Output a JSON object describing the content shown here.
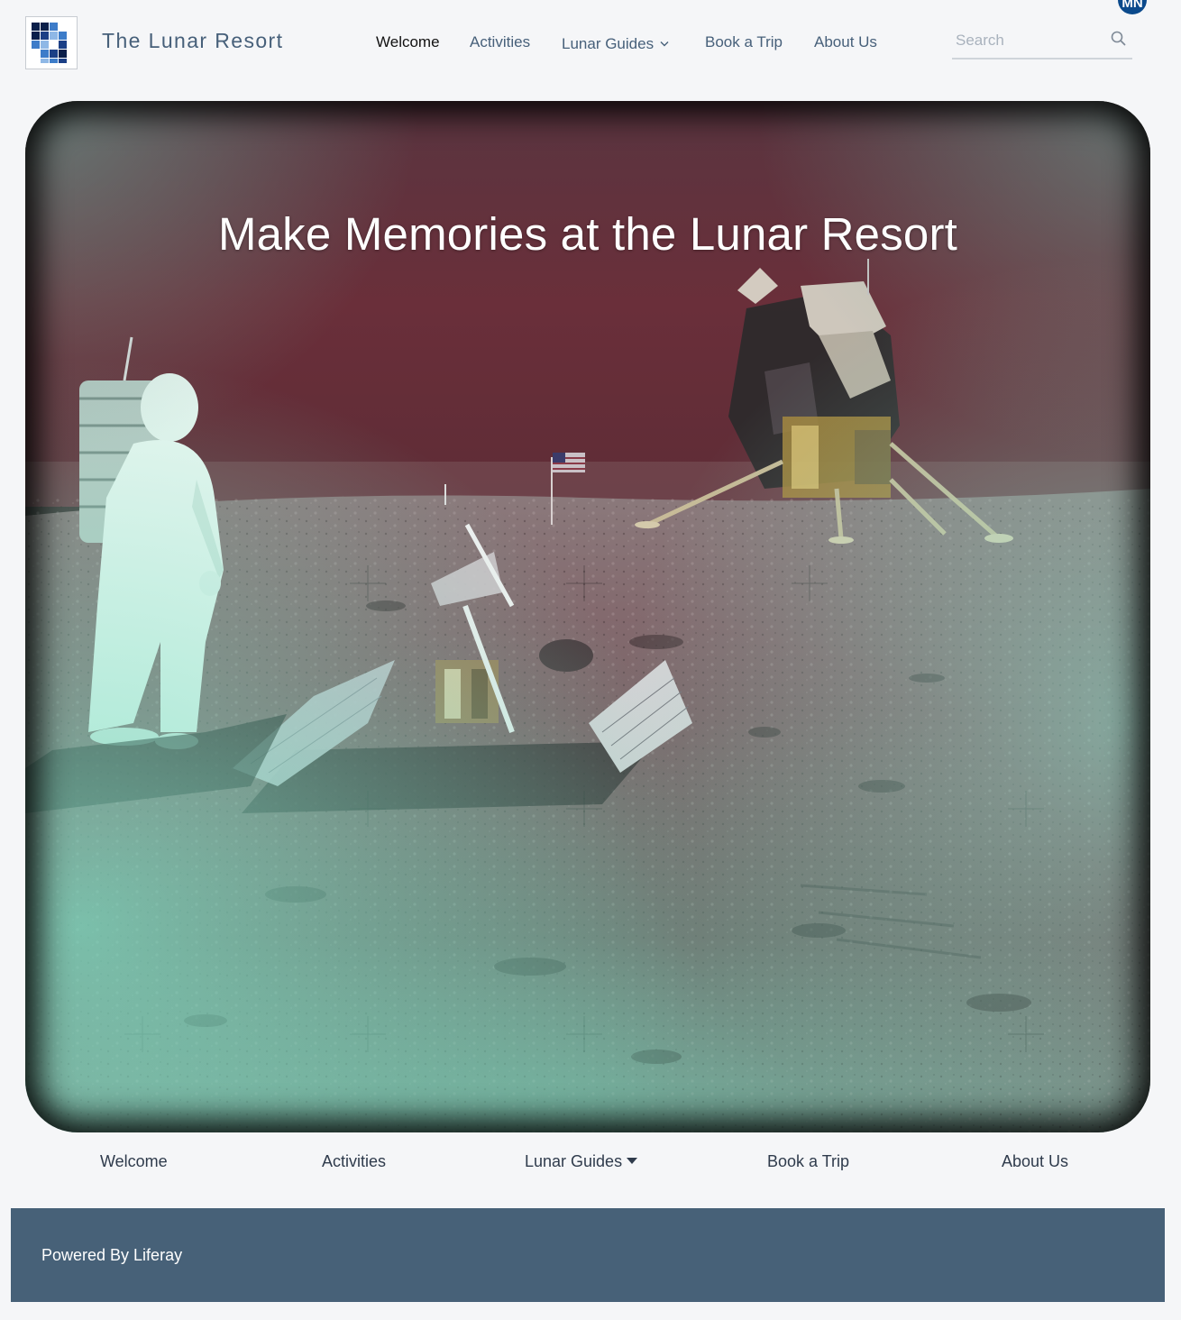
{
  "site": {
    "name": "The Lunar Resort",
    "logo_icon": "lunar-resort-logo-icon"
  },
  "nav": {
    "items": [
      {
        "label": "Welcome",
        "active": true
      },
      {
        "label": "Activities",
        "active": false
      },
      {
        "label": "Lunar Guides",
        "active": false,
        "has_dropdown": true
      },
      {
        "label": "Book a Trip",
        "active": false
      },
      {
        "label": "About Us",
        "active": false
      }
    ]
  },
  "search": {
    "placeholder": "Search",
    "value": "",
    "icon": "search-icon"
  },
  "user": {
    "initials": "MN",
    "avatar_color": "#0b4a8c"
  },
  "hero": {
    "title": "Make Memories at the Lunar Resort"
  },
  "subnav": {
    "items": [
      {
        "label": "Welcome"
      },
      {
        "label": "Activities"
      },
      {
        "label": "Lunar Guides",
        "has_dropdown": true
      },
      {
        "label": "Book a Trip"
      },
      {
        "label": "About Us"
      }
    ]
  },
  "footer": {
    "text": "Powered By Liferay",
    "background": "#476178"
  },
  "colors": {
    "nav_text": "#47607a",
    "nav_active": "#111111",
    "page_background": "#f5f6f8"
  }
}
